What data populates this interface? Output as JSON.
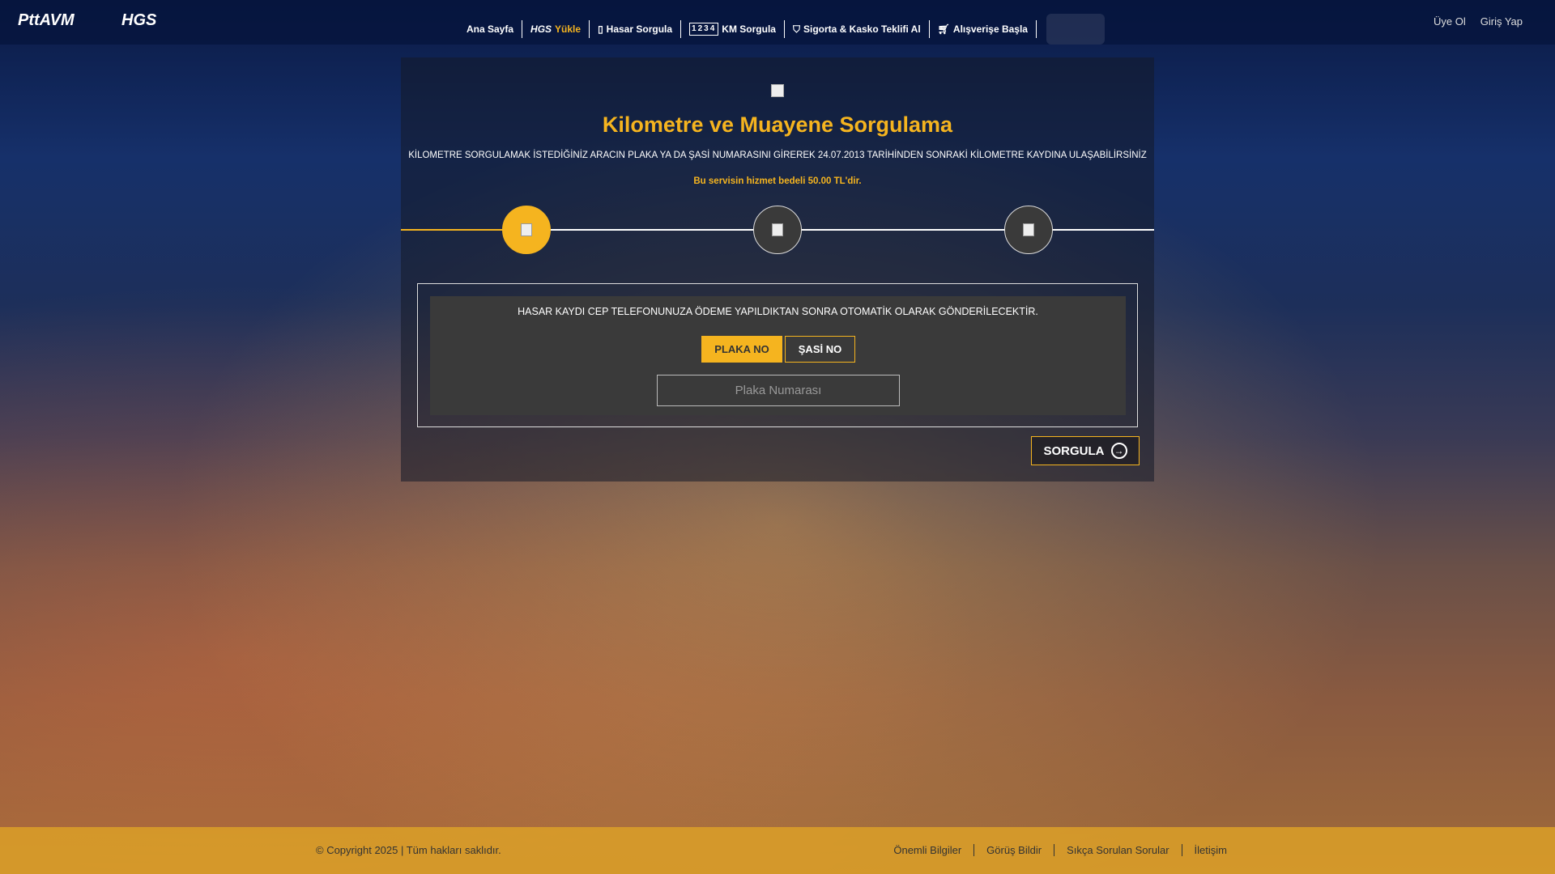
{
  "header": {
    "logo_main": "PttAVM",
    "logo_hgs": "HGS",
    "nav": [
      {
        "label": "Ana Sayfa",
        "icon": "none"
      },
      {
        "label": "Yükle",
        "prefix": "HGS",
        "icon": "hgs-icon"
      },
      {
        "label": "Hasar Sorgula",
        "icon": "document-icon"
      },
      {
        "label": "KM Sorgula",
        "icon": "odometer-icon",
        "prefix": "1234"
      },
      {
        "label": "Sigorta & Kasko Teklifi Al",
        "icon": "shield-icon"
      },
      {
        "label": "Alışverişe Başla",
        "icon": "cart-icon"
      }
    ],
    "register": "Üye Ol",
    "login": "Giriş Yap"
  },
  "main": {
    "title": "Kilometre ve Muayene Sorgulama",
    "subtitle": "KİLOMETRE SORGULAMAK İSTEDİĞİNİZ ARACIN PLAKA YA DA ŞASİ NUMARASINI GİREREK 24.07.2013 TARİHİNDEN SONRAKİ KİLOMETRE KAYDINA ULAŞABİLİRSİNİZ",
    "price_note": "Bu servisin hizmet bedeli 50.00 TL'dir.",
    "notice": "HASAR KAYDI CEP TELEFONUNUZA ÖDEME YAPILDIKTAN SONRA OTOMATİK OLARAK GÖNDERİLECEKTİR.",
    "tab_plate": "PLAKA NO",
    "tab_chassis": "ŞASİ NO",
    "input_placeholder": "Plaka Numarası",
    "submit": "SORGULA"
  },
  "footer": {
    "copyright": "© Copyright 2025 | Tüm hakları saklıdır.",
    "links": [
      "Önemli Bilgiler",
      "Görüş Bildir",
      "Sıkça Sorulan Sorular",
      "İletişim"
    ]
  },
  "colors": {
    "accent": "#f5b41f"
  }
}
